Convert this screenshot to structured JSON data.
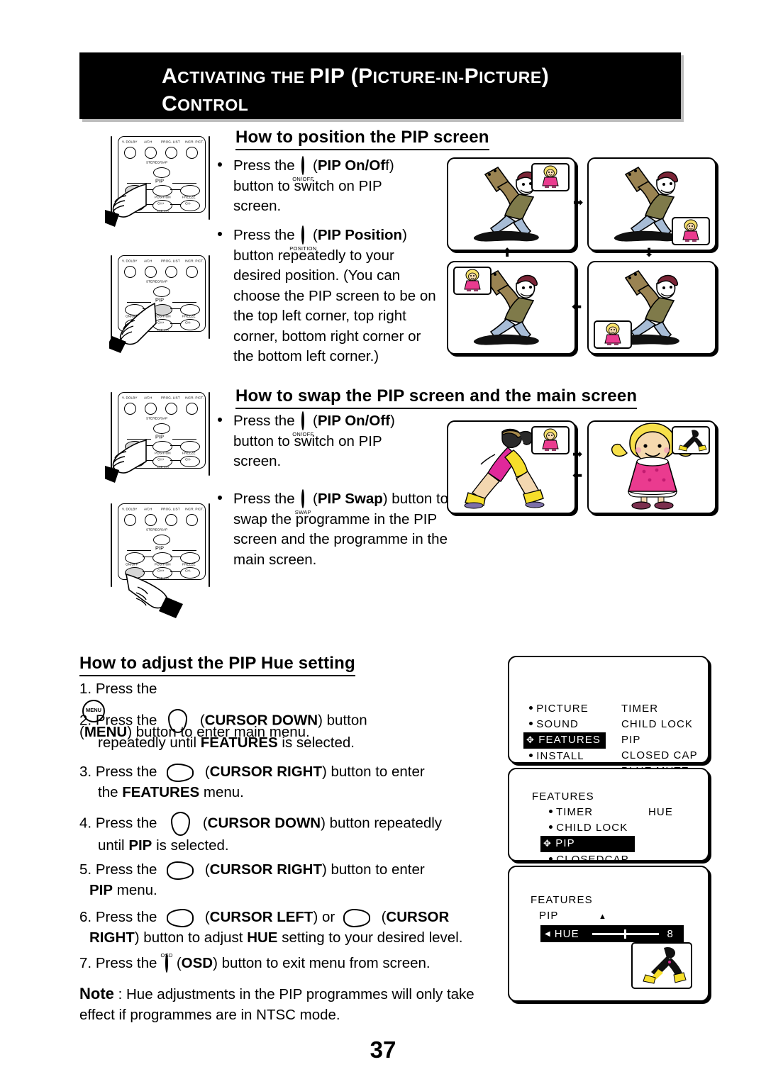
{
  "header": {
    "line1_a": "A",
    "line1_b": "CTIVATING THE ",
    "title_parts": [
      "A",
      "CTIVATING THE ",
      "PIP (",
      "P",
      "ICTURE",
      "-",
      "IN",
      "-",
      "P",
      "ICTURE",
      ")"
    ],
    "line1": "ACTIVATING THE PIP (PICTURE-IN-PICTURE)",
    "line2": "CONTROL"
  },
  "section1": {
    "heading": "How to position the PIP screen",
    "bullets": [
      {
        "pre": "Press the",
        "icon_label": "ON/OFF",
        "paren_open": "(",
        "bold": "PIP On/Of",
        "bold_tail": "f",
        "paren_close": ")",
        "rest": "button to switch on PIP screen."
      },
      {
        "pre": "Press the",
        "icon_label": "POSITION",
        "paren_open": "(",
        "bold": "PIP Position",
        "paren_close": ")",
        "rest": "button repeatedly to your desired position. (You can choose the PIP screen to be on the top left corner, top right corner, bottom right corner or the bottom left corner.)"
      }
    ],
    "tv_sequence": [
      {
        "pip_corner": "top-right",
        "main": "guitar-player",
        "pip": "girl"
      },
      {
        "pip_corner": "bottom-right",
        "main": "guitar-player",
        "pip": "girl"
      },
      {
        "pip_corner": "bottom-left",
        "main": "guitar-player",
        "pip": "girl"
      },
      {
        "pip_corner": "top-left",
        "main": "guitar-player",
        "pip": "girl"
      }
    ]
  },
  "section2": {
    "heading": "How to swap the PIP screen and the main screen",
    "bullets": [
      {
        "pre": "Press the",
        "icon_label": "ON/OFF",
        "paren_open": "(",
        "bold": "PIP On/Off",
        "paren_close": ")",
        "rest": "button to switch on PIP screen."
      },
      {
        "pre": "Press the",
        "icon_label": "SWAP",
        "paren_open": "(",
        "bold": "PIP Swap",
        "paren_close": ")",
        "rest": "button to swap the programme in the PIP screen and the programme in the main screen."
      }
    ],
    "tv_pair": [
      {
        "main": "dancer",
        "pip": "girl"
      },
      {
        "main": "girl",
        "pip": "dancer"
      }
    ]
  },
  "section3": {
    "heading": "How to adjust the PIP Hue setting",
    "steps": [
      {
        "num": "1.",
        "pre": "Press the",
        "icon": "menu-button",
        "icon_label": "MENU",
        "bold": "MENU",
        "rest": "button to enter main menu."
      },
      {
        "num": "2.",
        "pre": "Press the",
        "icon": "cursor-down",
        "bold": "CURSOR DOWN",
        "rest": "button",
        "rest2_pre": "repeatedly until",
        "rest2_bold": "FEATURES",
        "rest2_post": "is selected."
      },
      {
        "num": "3.",
        "pre": "Press the",
        "icon": "cursor-right",
        "bold": "CURSOR RIGHT",
        "rest": "button to enter",
        "rest2_pre": "the",
        "rest2_bold": "FEATURES",
        "rest2_post": "menu."
      },
      {
        "num": "4.",
        "pre": "Press the",
        "icon": "cursor-down",
        "bold": "CURSOR DOWN",
        "rest": "button repeatedly",
        "rest2_pre": "until",
        "rest2_bold": "PIP",
        "rest2_post": "is selected."
      },
      {
        "num": "5.",
        "pre": "Press the",
        "icon": "cursor-right",
        "bold": "CURSOR RIGHT",
        "rest": "button to enter",
        "rest2_bold": "PIP",
        "rest2_post": "menu."
      },
      {
        "num": "6.",
        "pre": "Press the",
        "icon": "cursor-left",
        "bold": "CURSOR LEFT",
        "mid": ") or",
        "icon2": "cursor-right",
        "bold2": "CURSOR",
        "bold2b": "RIGHT",
        "rest": ") button to adjust",
        "rest_bold": "HUE",
        "rest_post": "setting to your desired level."
      },
      {
        "num": "7.",
        "pre": "Press the",
        "icon": "osd-button",
        "icon_label": "OSD",
        "bold": "OSD",
        "rest": "button to exit menu from screen."
      }
    ],
    "note_label": "Note",
    "note_colon": ":",
    "note_text": "Hue adjustments in the PIP programmes will only take effect if programmes are in NTSC mode."
  },
  "osd_menus": [
    {
      "name": "main-menu",
      "left_items": [
        {
          "label": "PICTURE",
          "selected": false
        },
        {
          "label": "SOUND",
          "selected": false
        },
        {
          "label": "FEATURES",
          "selected": true
        },
        {
          "label": "INSTALL",
          "selected": false
        }
      ],
      "right_items": [
        "TIMER",
        "CHILD LOCK",
        "PIP",
        "CLOSED CAP",
        "BLUE MUTE"
      ]
    },
    {
      "name": "features-menu",
      "title": "FEATURES",
      "items": [
        {
          "label": "TIMER",
          "selected": false,
          "value": "HUE"
        },
        {
          "label": "CHILD LOCK",
          "selected": false
        },
        {
          "label": "PIP",
          "selected": true
        },
        {
          "label": "CLOSEDCAP",
          "selected": false
        }
      ]
    },
    {
      "name": "pip-hue-menu",
      "title": "FEATURES",
      "subtitle": "PIP",
      "slider_label": "HUE",
      "slider_value": "8",
      "slider_percent": 50,
      "pip_thumb": "dancer"
    }
  ],
  "remotes": [
    {
      "name": "remote-on-off-1",
      "pressed": "ON/OFF"
    },
    {
      "name": "remote-position",
      "pressed": "POSITION"
    },
    {
      "name": "remote-on-off-2",
      "pressed": "ON/OFF"
    },
    {
      "name": "remote-swap",
      "pressed": "SWAP"
    }
  ],
  "remote_labels": {
    "row1": [
      "V. DOLBY",
      "A/CH",
      "PROG. LIST",
      "INCR. PICT."
    ],
    "stereo": "STEREO/SAP",
    "pip_group": "PIP",
    "row_mid": [
      "ON/OFF",
      "POSITION",
      "FREEZE"
    ],
    "row_bot_left": "SWAP",
    "row_bot_mid": "CH+",
    "row_bot_right": "CH-",
    "pip_ch": "PIP CH"
  },
  "page_number": "37"
}
